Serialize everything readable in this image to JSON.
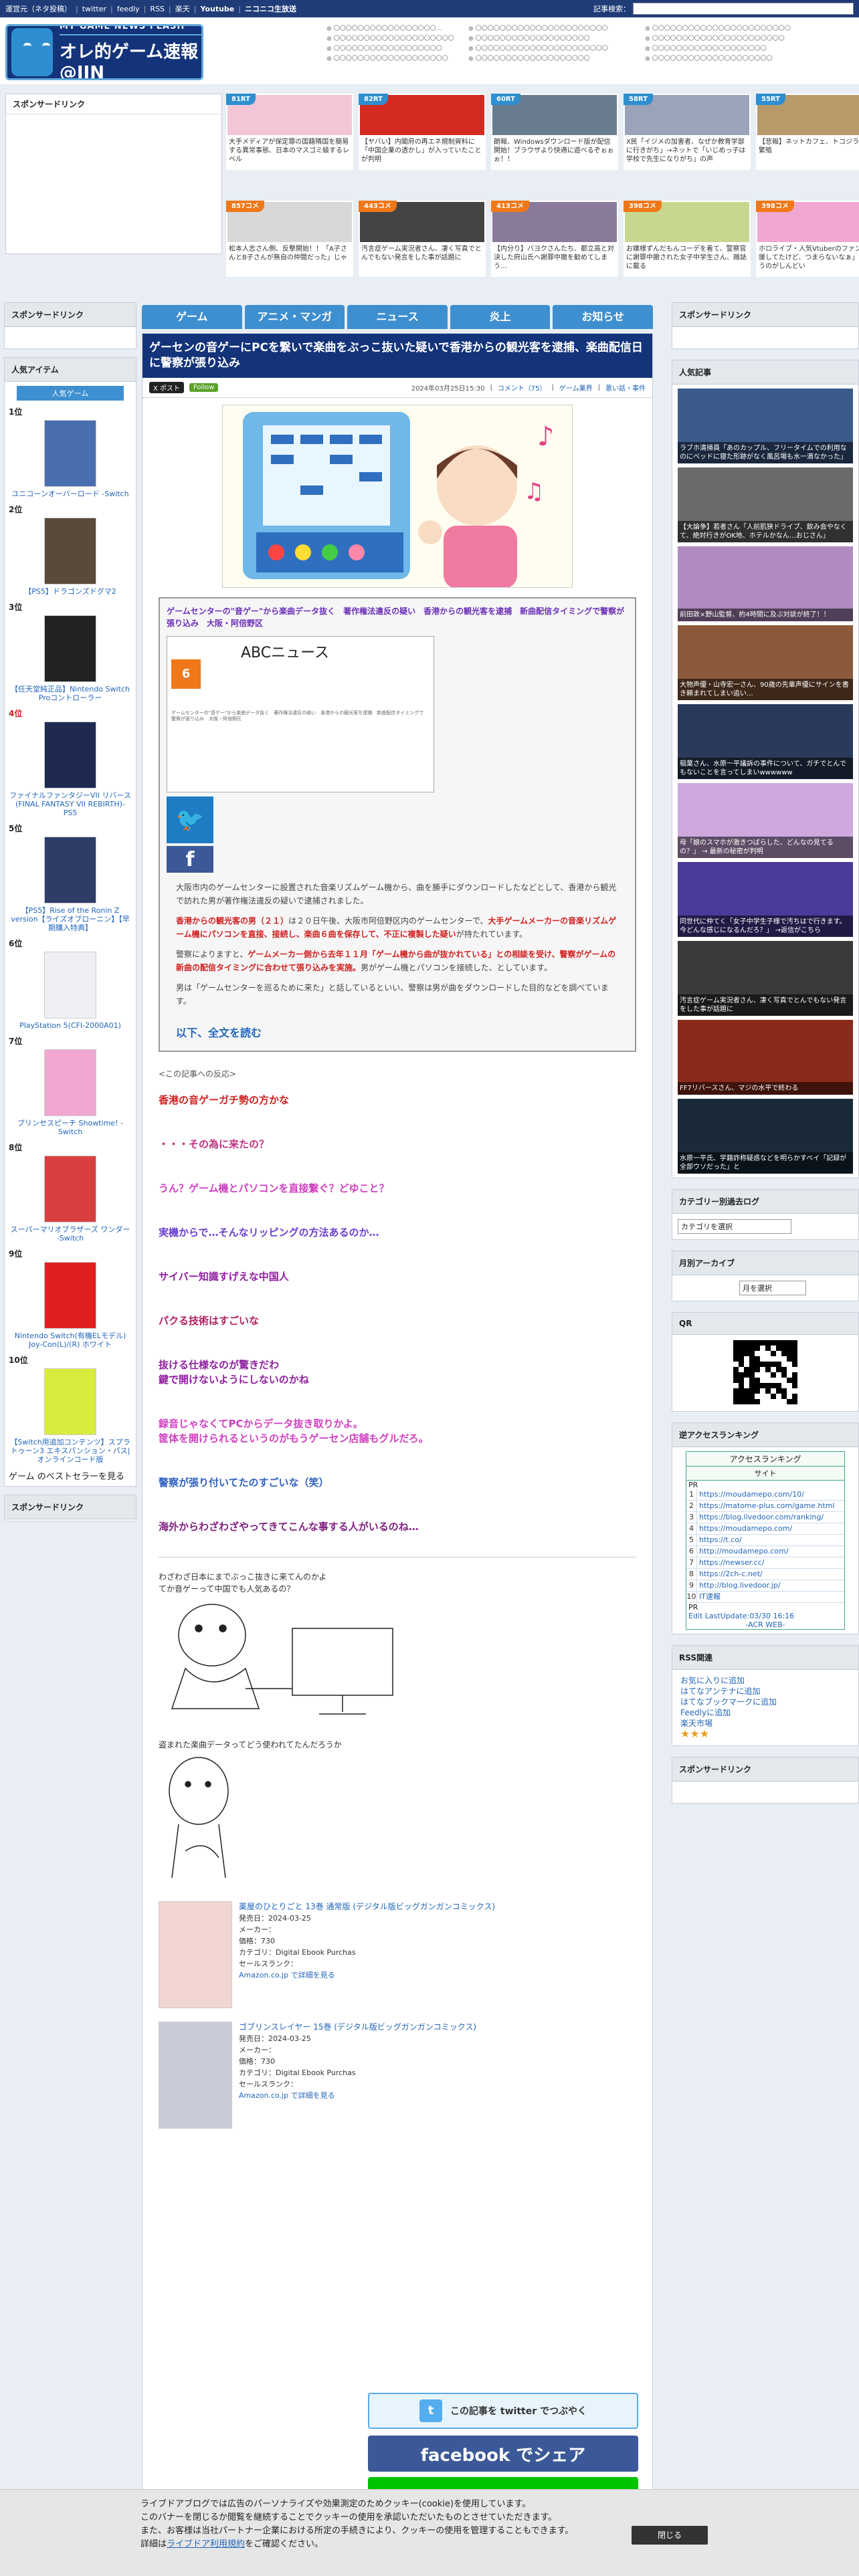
{
  "topbar": {
    "links": [
      "運営元（ネタ投稿）",
      "twitter",
      "feedly",
      "RSS",
      "楽天",
      "Youtube",
      "ニコニコ生放送"
    ],
    "search_label": "記事検索："
  },
  "logo": {
    "sub": "MY GAME NEWS FLASH",
    "main": "オレ的ゲーム速報@JIN"
  },
  "header_link_cols": [
    [
      "〇〇〇〇〇〇〇〇〇〇〇〇〇〇〇〇〇...",
      "〇〇〇〇〇〇〇〇〇〇〇〇〇〇〇〇〇〇〇〇",
      "〇〇〇〇〇〇〇〇〇〇〇〇〇〇〇〇〇〇",
      "〇〇〇〇〇〇〇〇〇〇〇〇〇〇〇〇〇〇〇"
    ],
    [
      "〇〇〇〇〇〇〇〇〇〇〇〇〇〇〇〇〇〇〇〇〇〇",
      "〇〇〇〇〇〇〇〇〇〇〇〇〇〇〇〇〇〇〇",
      "〇〇〇〇〇〇〇〇〇〇〇〇〇〇〇〇〇〇〇〇〇〇",
      "〇〇〇〇〇〇〇〇〇〇〇〇〇〇〇〇〇〇〇"
    ],
    [
      "〇〇〇〇〇〇〇〇〇〇〇〇〇〇〇〇〇〇〇〇〇〇〇",
      "〇〇〇〇〇〇〇〇〇〇〇〇〇〇〇〇〇〇〇〇〇〇",
      "〇〇〇〇〇〇〇〇〇〇〇〇〇〇〇〇〇〇〇",
      "〇〇〇〇〇〇〇〇〇〇〇〇〇〇〇〇〇〇〇〇"
    ]
  ],
  "sponsor": "スポンサードリンク",
  "top_thumbs": [
    {
      "count": "81RT",
      "text": "大手メディアが保定罪の国籍隣国を簡易する異常事態、日本のマスゴミ級するレベル"
    },
    {
      "count": "82RT",
      "text": "【ヤバい】内閣府の再エネ規制資料に「中国企業の透かし」が入っていたことが判明"
    },
    {
      "count": "60RT",
      "text": "朗報、Windowsダウンロード版が配信開始！ブラウザより快適に遊べるぞぉぉぉ！！"
    },
    {
      "count": "58RT",
      "text": "X民「イジメの加害者、なぜか教育学部に行きがち」→ネットで「いじめっ子は学校で先生になりがち」の声"
    },
    {
      "count": "55RT",
      "text": "【悲報】ネットカフェ、トコジラミが大繁殖"
    },
    {
      "count": "857コメ",
      "text": "松本人志さん側、反撃開始！！「A子さんとB子さんが無自の仲間だった」じゃ"
    },
    {
      "count": "443コメ",
      "text": "汚言症ゲーム実況者さん、凄く写真でとんでもない発言をした事が話題に"
    },
    {
      "count": "413コメ",
      "text": "【内分り】バヨクさんたち、都立高と対決した府山氏へ謝罪中撤を勧めてしまう…"
    },
    {
      "count": "398コメ",
      "text": "お嬢様ずんだもんコーデを着て、警察官に謝罪中撤された女子中学生さん、雑誌に載る"
    },
    {
      "count": "398コメ",
      "text": "ホロライブ・人気Vtuberのファン「応援してたけど、つまらないなぁ」っていうのがしんどい"
    }
  ],
  "nav": {
    "tabs": [
      "ゲーム",
      "アニメ・マンガ",
      "ニュース",
      "炎上",
      "お知らせ"
    ]
  },
  "left": {
    "popular_title": "人気アイテム",
    "popular_tab": "人気ゲーム",
    "ranks": [
      {
        "rank": "1位",
        "title": "ユニコーンオーバーロード -Switch"
      },
      {
        "rank": "2位",
        "title": "【PS5】ドラゴンズドグマ2"
      },
      {
        "rank": "3位",
        "title": "【任天堂純正品】Nintendo Switch Proコントローラー"
      },
      {
        "rank": "4位",
        "title": "ファイナルファンタジーVII リバース(FINAL FANTASY VII REBIRTH)-PS5"
      },
      {
        "rank": "5位",
        "title": "【PS5】Rise of the Ronin Z version【ライズオブローニン】【早期購入特典】"
      },
      {
        "rank": "6位",
        "title": "PlayStation 5(CFI-2000A01)"
      },
      {
        "rank": "7位",
        "title": "プリンセスピーチ Showtime! -Switch"
      },
      {
        "rank": "8位",
        "title": "スーパーマリオブラザーズ ワンダー -Switch"
      },
      {
        "rank": "9位",
        "title": "Nintendo Switch(有機ELモデル) Joy-Con(L)/(R) ホワイト"
      },
      {
        "rank": "10位",
        "title": "【Switch用追加コンテンツ】スプラトゥーン3 エキスパンション・パス|オンラインコード版"
      }
    ],
    "bestseller": "ゲーム のベストセラーを見る",
    "sponsor2": "スポンサードリンク"
  },
  "article": {
    "title": "ゲーセンの音ゲーにPCを繋いで楽曲をぶっこ抜いた疑いで香港からの観光客を逮捕、楽曲配信日に警察が張り込み",
    "x_label": "X ポスト",
    "follow_label": "Follow",
    "date": "2024年03月25日15:30",
    "comments": "コメント（75）",
    "category": "ゲーム業界",
    "tag": "悪い話・事件",
    "quote_title": "ゲームセンターの\"音ゲー\"から楽曲データ抜く　著作権法違反の疑い　香港からの観光客を逮捕　新曲配信タイミングで警察が張り込み　大阪・阿倍野区",
    "abc_title": "ABCニュース",
    "abc_six": "6",
    "abc_small": "ゲームセンターの\"音ゲー\"から楽曲データ抜く　著作権法違反の疑い　香港からの観光客を逮捕　新曲配信タイミングで警察が張り込み　大阪・阿倍野区",
    "para1": "大阪市内のゲームセンターに設置された音楽リズムゲーム機から、曲を勝手にダウンロードしたなどとして、香港から観光で訪れた男が著作権法違反の疑いで逮捕されました。",
    "para2_red1": "香港からの観光客の男（２１）",
    "para2_mid": "は２０日午後、大阪市阿倍野区内のゲームセンターで、",
    "para2_red2": "大手ゲームメーカーの音楽リズムゲーム機にパソコンを直接、接続し、楽曲６曲を保存して、不正に複製した疑い",
    "para2_end": "が持たれています。",
    "para3_a": "警察によりますと、",
    "para3_red": "ゲームメーカー側から去年１１月「ゲーム機から曲が抜かれている」との相談を受け、警察がゲームの新曲の配信タイミングに合わせて張り込みを実施。",
    "para3_b": "男がゲーム機とパソコンを接続した、としています。",
    "para4": "男は「ゲームセンターを巡るために来た」と話しているといい、警察は男が曲をダウンロードした目的などを調べています。",
    "readmore": "以下、全文を読む",
    "reactions_header": "<この記事への反応>",
    "reactions": [
      "香港の音ゲーガチ勢の方かな",
      "・・・その為に来たの？",
      "うん？ゲーム機とパソコンを直接繋ぐ？どゆこと？",
      "実機からで…そんなリッピングの方法あるのか…",
      "サイバー知識すげえな中国人",
      "パクる技術はすごいな",
      "抜ける仕様なのが驚きだわ\n鍵で開けないようにしないのかね",
      "録音じゃなくてPCからデータ抜き取りかよ。\n筐体を開けられるというのがもうゲーセン店舗もグルだろ。",
      "警察が張り付いてたのすごいな（笑）",
      "海外からわざわざやってきてこんな事する人がいるのね…"
    ],
    "aa1_text": "わざわざ日本にまでぶっこ抜きに来てんのかよ\nてか音ゲーって中国でも人気あるの？",
    "aa2_text": "盗まれた楽曲データってどう使われてたんだろうか",
    "ads": [
      {
        "title": "薬屋のひとりごと 13巻 通常版 (デジタル版ビッグガンガンコミックス)",
        "date": "発売日：2024-03-25",
        "maker": "メーカー：",
        "price": "価格：730",
        "cat": "カテゴリ：Digital Ebook Purchas",
        "rank": "セールスランク：",
        "link": "Amazon.co.jp で詳細を見る"
      },
      {
        "title": "ゴブリンスレイヤー 15巻 (デジタル版ビッグガンガンコミックス)",
        "date": "発売日：2024-03-25",
        "maker": "メーカー：",
        "price": "価格：730",
        "cat": "カテゴリ：Digital Ebook Purchas",
        "rank": "セールスランク：",
        "link": "Amazon.co.jp で詳細を見る"
      }
    ],
    "share_twitter": "この記事を twitter でつぶやく",
    "share_facebook": "facebook でシェア"
  },
  "right": {
    "sponsor": "スポンサードリンク",
    "popular_title": "人気記事",
    "popular": [
      "ラブホ清掃員「あのカップル、フリータイムでの利用なのにベッドに寝た形跡がなく風呂場も水一滴なかった」",
      "【大論争】若者さん「人前肌狭ドライブ、飲み会やなくて、絶対行きがOK地、ホテルかなん…おじさん」",
      "前田敦×野山監督、約4時間に及ぶ対談が終了！！",
      "大物声優・山寺宏一さん、90歳の先輩声優にサインを書き頼まれてしまい追い…",
      "稲葉さん、水原一平議訴の事件について、ガチでとんでもないことを言ってしまいwwwwww",
      "母「娘のスマホが激きつばらした、どんなの見てるの？」 → 最新の秘密が判明",
      "同世代に仲てく「女子中学生子様で汚ちはで行きます。今どんな感じになるんだろ？」 →返信がこちら",
      "汚言症ゲーム実況者さん、凄く写真でとんでもない発言をした事が話題に",
      "FF7リバースさん、マジの水平で終わる",
      "水原一平氏、学籍詐称疑惑などを明らかすべイ「記録が全部ウソだった」と"
    ],
    "category_title": "カテゴリー別過去ログ",
    "category_select": "カテゴリを選択",
    "monthly_title": "月別アーカイブ",
    "monthly_select": "月を選択",
    "qr_title": "QR",
    "access_title": "逆アクセスランキング",
    "access_header": "アクセスランキング",
    "access_sub": "サイト",
    "access_pr": "PR",
    "access": [
      "https://moudamepo.com/10/",
      "https://matome-plus.com/game.html",
      "https://blog.livedoor.com/ranking/",
      "https://moudamepo.com/",
      "https://t.co/",
      "http://moudamepo.com/",
      "https://newser.cc/",
      "https://2ch-c.net/",
      "http://blog.livedoor.jp/",
      "IT速報"
    ],
    "access_pr2": "PR",
    "access_foot": "Edit LastUpdate:03/30 16:16",
    "access_acr": "-ACR WEB-",
    "rss_title": "RSS関連",
    "rss_links": [
      "お気に入りに追加",
      "はてなアンテナに追加",
      "はてなブックマークに追加",
      "Feedlyに追加",
      "楽天市場"
    ],
    "sponsor2": "スポンサードリンク"
  },
  "cookie": {
    "line1": "ライブドアブログでは広告のパーソナライズや効果測定のためクッキー(cookie)を使用しています。",
    "line2": "このバナーを閉じるか閲覧を継続することでクッキーの使用を承認いただいたものとさせていただきます。",
    "line3": "また、お客様は当社パートナー企業における所定の手続きにより、クッキーの使用を管理することもできます。",
    "line4a": "詳細は",
    "line4link": "ライブドア利用規約",
    "line4b": "をご確認ください。",
    "close": "閉じる"
  }
}
